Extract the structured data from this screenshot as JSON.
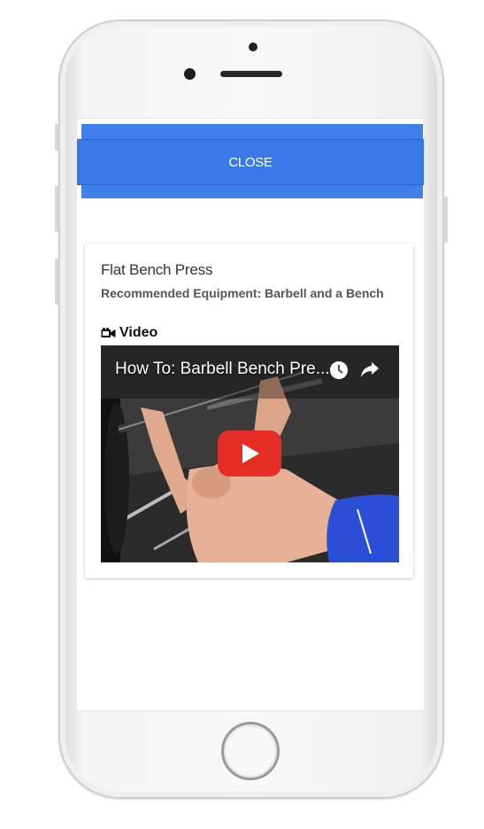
{
  "modal": {
    "close_label": "CLOSE"
  },
  "exercise": {
    "title": "Flat Bench Press",
    "equipment": "Recommended Equipment: Barbell and a Bench",
    "video_label": "Video",
    "video_title": "How To: Barbell Bench Pre..."
  },
  "colors": {
    "primary": "#3a7ae8",
    "youtube_red": "#e52d27"
  },
  "icons": [
    "video-camera-icon",
    "clock-icon",
    "share-icon",
    "play-icon",
    "home-button"
  ]
}
